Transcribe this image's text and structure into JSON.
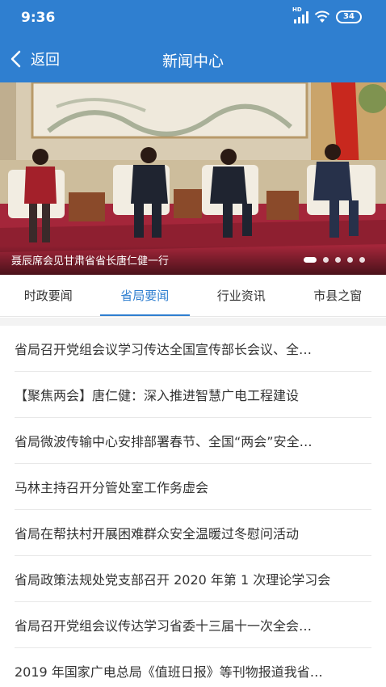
{
  "status_bar": {
    "time": "9:36",
    "signal_tag": "HD",
    "battery": "34",
    "icons": [
      "signal-icon",
      "wifi-icon",
      "battery-icon"
    ]
  },
  "header": {
    "back_label": "返回",
    "back_icon": "chevron-left-icon",
    "title": "新闻中心"
  },
  "banner": {
    "caption": "聂辰席会见甘肃省省长唐仁健一行",
    "slide_count": 5,
    "active_slide": 1
  },
  "tabs": [
    {
      "label": "时政要闻",
      "active": false
    },
    {
      "label": "省局要闻",
      "active": true
    },
    {
      "label": "行业资讯",
      "active": false
    },
    {
      "label": "市县之窗",
      "active": false
    }
  ],
  "news": [
    {
      "title": "省局召开党组会议学习传达全国宣传部长会议、全…"
    },
    {
      "title": "【聚焦两会】唐仁健：深入推进智慧广电工程建设"
    },
    {
      "title": "省局微波传输中心安排部署春节、全国“两会”安全…"
    },
    {
      "title": "马林主持召开分管处室工作务虚会"
    },
    {
      "title": "省局在帮扶村开展困难群众安全温暖过冬慰问活动"
    },
    {
      "title": "省局政策法规处党支部召开 2020 年第 1 次理论学习会"
    },
    {
      "title": "省局召开党组会议传达学习省委十三届十一次全会…"
    },
    {
      "title": "2019 年国家广电总局《值班日报》等刊物报道我省…"
    }
  ],
  "colors": {
    "primary": "#2f7fd0",
    "tab_active": "#2f7fd0",
    "text": "#333333",
    "divider": "#f3f3f3"
  }
}
